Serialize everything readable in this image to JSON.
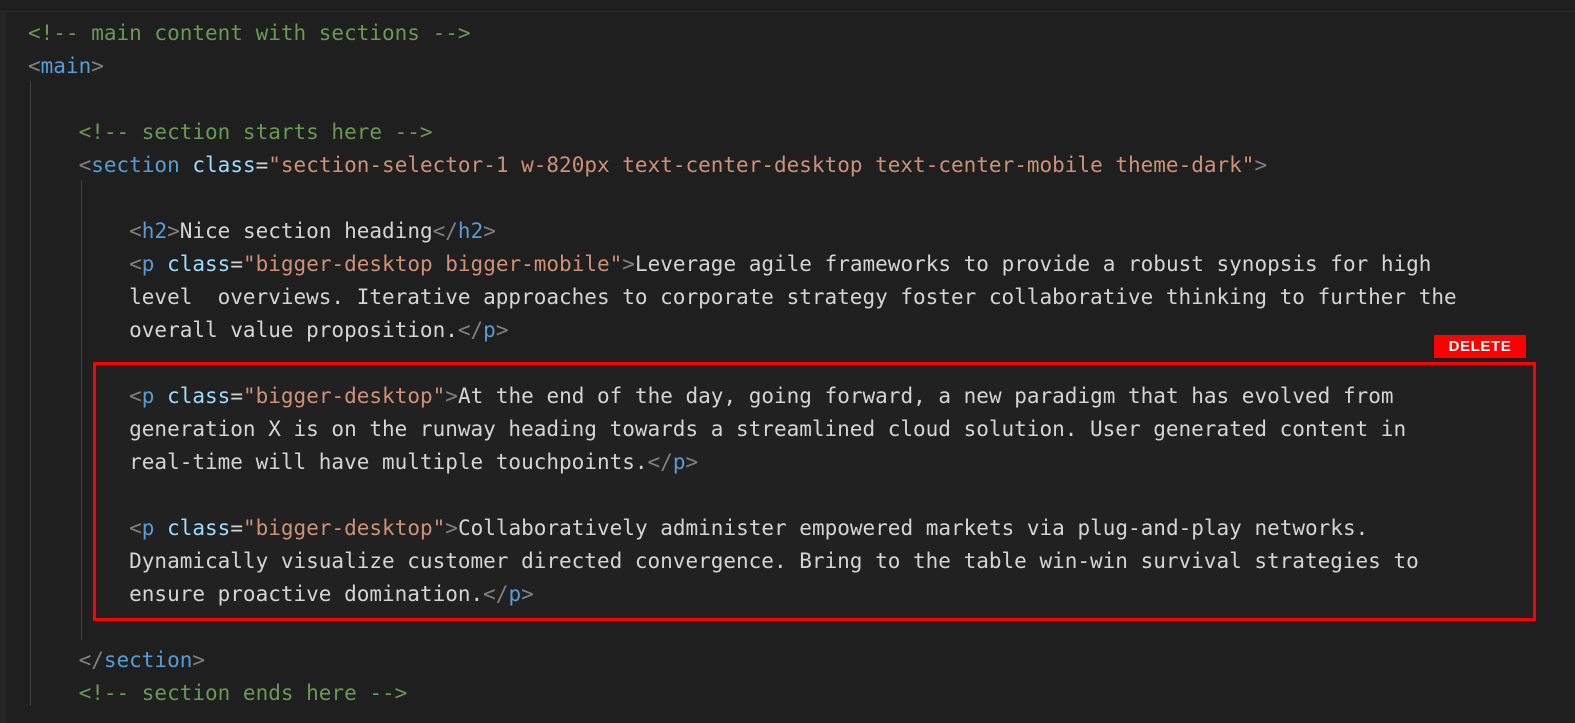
{
  "editor": {
    "background_color": "#1f1f1f",
    "syntax_colors": {
      "comment": "#6a9955",
      "tag": "#569cd6",
      "attribute": "#9cdcfe",
      "string": "#ce9178",
      "punctuation": "#808080",
      "text": "#d4d4d4",
      "highlight_border": "#ff0000",
      "badge_background": "#ff0000",
      "badge_text": "#ffffff"
    }
  },
  "badge": {
    "label": "DELETE"
  },
  "code_lines": [
    {
      "id": "line-comment-main-open",
      "indent": 0,
      "tokens": [
        {
          "cls": "t-comment",
          "text": "<!-- main content with sections -->"
        }
      ]
    },
    {
      "id": "line-main-open",
      "indent": 0,
      "tokens": [
        {
          "cls": "t-punct",
          "text": "<"
        },
        {
          "cls": "t-tag",
          "text": "main"
        },
        {
          "cls": "t-punct",
          "text": ">"
        }
      ]
    },
    {
      "id": "line-blank-1",
      "indent": 0,
      "tokens": [
        {
          "cls": "t-text",
          "text": " "
        }
      ]
    },
    {
      "id": "line-comment-section-start",
      "indent": 0,
      "tokens": [
        {
          "cls": "t-comment",
          "text": "    <!-- section starts here -->"
        }
      ]
    },
    {
      "id": "line-section-open",
      "indent": 0,
      "tokens": [
        {
          "cls": "t-punct",
          "text": "    <"
        },
        {
          "cls": "t-tag",
          "text": "section"
        },
        {
          "cls": "t-text",
          "text": " "
        },
        {
          "cls": "t-attr",
          "text": "class"
        },
        {
          "cls": "t-eq",
          "text": "="
        },
        {
          "cls": "t-string",
          "text": "\"section-selector-1 w-820px text-center-desktop text-center-mobile theme-dark\""
        },
        {
          "cls": "t-punct",
          "text": ">"
        }
      ]
    },
    {
      "id": "line-blank-2",
      "indent": 0,
      "tokens": [
        {
          "cls": "t-text",
          "text": " "
        }
      ]
    },
    {
      "id": "line-h2",
      "indent": 0,
      "tokens": [
        {
          "cls": "t-punct",
          "text": "        <"
        },
        {
          "cls": "t-tag",
          "text": "h2"
        },
        {
          "cls": "t-punct",
          "text": ">"
        },
        {
          "cls": "t-text",
          "text": "Nice section heading"
        },
        {
          "cls": "t-punct",
          "text": "</"
        },
        {
          "cls": "t-tag",
          "text": "h2"
        },
        {
          "cls": "t-punct",
          "text": ">"
        }
      ]
    },
    {
      "id": "line-p1-a",
      "indent": 0,
      "tokens": [
        {
          "cls": "t-punct",
          "text": "        <"
        },
        {
          "cls": "t-tag",
          "text": "p"
        },
        {
          "cls": "t-text",
          "text": " "
        },
        {
          "cls": "t-attr",
          "text": "class"
        },
        {
          "cls": "t-eq",
          "text": "="
        },
        {
          "cls": "t-string",
          "text": "\"bigger-desktop bigger-mobile\""
        },
        {
          "cls": "t-punct",
          "text": ">"
        },
        {
          "cls": "t-text",
          "text": "Leverage agile frameworks to provide a robust synopsis for high"
        }
      ]
    },
    {
      "id": "line-p1-b",
      "indent": 0,
      "tokens": [
        {
          "cls": "t-text",
          "text": "        level  overviews. Iterative approaches to corporate strategy foster collaborative thinking to further the"
        }
      ]
    },
    {
      "id": "line-p1-c",
      "indent": 0,
      "tokens": [
        {
          "cls": "t-text",
          "text": "        overall value proposition."
        },
        {
          "cls": "t-punct",
          "text": "</"
        },
        {
          "cls": "t-tag",
          "text": "p"
        },
        {
          "cls": "t-punct",
          "text": ">"
        }
      ]
    },
    {
      "id": "line-blank-3",
      "indent": 0,
      "tokens": [
        {
          "cls": "t-text",
          "text": " "
        }
      ]
    },
    {
      "id": "line-p2-a",
      "indent": 0,
      "tokens": [
        {
          "cls": "t-punct",
          "text": "        <"
        },
        {
          "cls": "t-tag",
          "text": "p"
        },
        {
          "cls": "t-text",
          "text": " "
        },
        {
          "cls": "t-attr",
          "text": "class"
        },
        {
          "cls": "t-eq",
          "text": "="
        },
        {
          "cls": "t-string",
          "text": "\"bigger-desktop\""
        },
        {
          "cls": "t-punct",
          "text": ">"
        },
        {
          "cls": "t-text",
          "text": "At the end of the day, going forward, a new paradigm that has evolved from"
        }
      ]
    },
    {
      "id": "line-p2-b",
      "indent": 0,
      "tokens": [
        {
          "cls": "t-text",
          "text": "        generation X is on the runway heading towards a streamlined cloud solution. User generated content in"
        }
      ]
    },
    {
      "id": "line-p2-c",
      "indent": 0,
      "tokens": [
        {
          "cls": "t-text",
          "text": "        real-time will have multiple touchpoints."
        },
        {
          "cls": "t-punct",
          "text": "</"
        },
        {
          "cls": "t-tag",
          "text": "p"
        },
        {
          "cls": "t-punct",
          "text": ">"
        }
      ]
    },
    {
      "id": "line-blank-4",
      "indent": 0,
      "tokens": [
        {
          "cls": "t-text",
          "text": " "
        }
      ]
    },
    {
      "id": "line-p3-a",
      "indent": 0,
      "tokens": [
        {
          "cls": "t-punct",
          "text": "        <"
        },
        {
          "cls": "t-tag",
          "text": "p"
        },
        {
          "cls": "t-text",
          "text": " "
        },
        {
          "cls": "t-attr",
          "text": "class"
        },
        {
          "cls": "t-eq",
          "text": "="
        },
        {
          "cls": "t-string",
          "text": "\"bigger-desktop\""
        },
        {
          "cls": "t-punct",
          "text": ">"
        },
        {
          "cls": "t-text",
          "text": "Collaboratively administer empowered markets via plug-and-play networks."
        }
      ]
    },
    {
      "id": "line-p3-b",
      "indent": 0,
      "tokens": [
        {
          "cls": "t-text",
          "text": "        Dynamically visualize customer directed convergence. Bring to the table win-win survival strategies to"
        }
      ]
    },
    {
      "id": "line-p3-c",
      "indent": 0,
      "tokens": [
        {
          "cls": "t-text",
          "text": "        ensure proactive domination."
        },
        {
          "cls": "t-punct",
          "text": "</"
        },
        {
          "cls": "t-tag",
          "text": "p"
        },
        {
          "cls": "t-punct",
          "text": ">"
        }
      ]
    },
    {
      "id": "line-blank-5",
      "indent": 0,
      "tokens": [
        {
          "cls": "t-text",
          "text": " "
        }
      ]
    },
    {
      "id": "line-section-close",
      "indent": 0,
      "tokens": [
        {
          "cls": "t-punct",
          "text": "    </"
        },
        {
          "cls": "t-tag",
          "text": "section"
        },
        {
          "cls": "t-punct",
          "text": ">"
        }
      ]
    },
    {
      "id": "line-comment-section-end",
      "indent": 0,
      "tokens": [
        {
          "cls": "t-comment",
          "text": "    <!-- section ends here -->"
        }
      ]
    }
  ]
}
